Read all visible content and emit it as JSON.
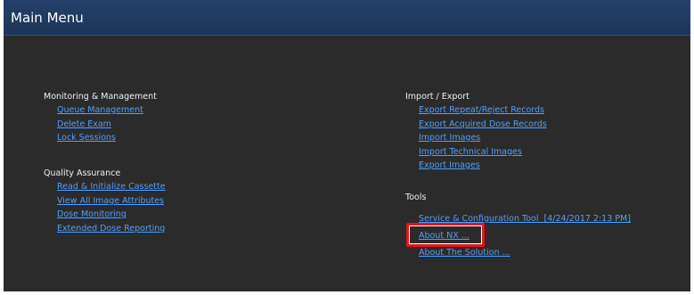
{
  "window": {
    "title": "Main Menu"
  },
  "monitoring": {
    "title": "Monitoring & Management",
    "links": [
      "Queue Management",
      "Delete Exam",
      "Lock Sessions"
    ]
  },
  "quality": {
    "title": "Quality Assurance",
    "links": [
      "Read & Initialize Cassette",
      "View All Image Attributes",
      "Dose Monitoring",
      "Extended Dose Reporting"
    ]
  },
  "import_export": {
    "title": "Import / Export",
    "links": [
      "Export Repeat/Reject Records",
      "Export Acquired Dose Records",
      "Import Images",
      "Import Technical Images",
      "Export Images"
    ]
  },
  "tools": {
    "title": "Tools",
    "links": [
      "Service & Configuration Tool  [4/24/2017 2:13 PM]",
      "About NX ...",
      "About The Solution ..."
    ]
  },
  "colors": {
    "titlebar": "#1d3558",
    "background": "#2b2b2b",
    "link": "#4f9fff",
    "highlight": "#e2161d"
  }
}
